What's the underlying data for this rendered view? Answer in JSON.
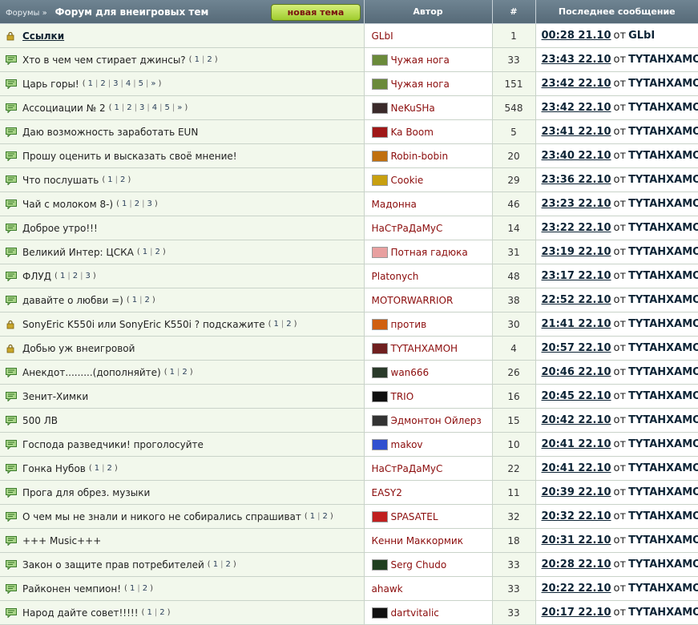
{
  "header": {
    "breadcrumb": "Форумы »",
    "title": "Форум для внеигровых тем",
    "new_topic_button": "новая тема",
    "col_author": "Автор",
    "col_count": "#",
    "col_last": "Последнее сообщение"
  },
  "colors": {
    "header_bg": "#607583",
    "row_bg": "#f2f8ec",
    "author_color": "#8b0c0c",
    "button_green": "#b6dc4e"
  },
  "topics": [
    {
      "title": "Ссылки",
      "bold": true,
      "icon": "lock-icon",
      "pages": [],
      "author": "GLbI",
      "avatar": null,
      "count": "1",
      "last_time": "00:28 21.10",
      "last_user": "GLbI"
    },
    {
      "title": "Хто в чем чем стирает джинсы?",
      "icon": "topic-icon",
      "pages": [
        "1",
        "2"
      ],
      "author": "Чужая нога",
      "avatar": {
        "name": "smiley-avatar-icon",
        "color": "#6a8a3a"
      },
      "count": "33",
      "last_time": "23:43 22.10",
      "last_user": "TYTAHXAMOH"
    },
    {
      "title": "Царь горы!",
      "icon": "topic-icon",
      "pages": [
        "1",
        "2",
        "3",
        "4",
        "5",
        "»"
      ],
      "author": "Чужая нога",
      "avatar": {
        "name": "smiley-avatar-icon",
        "color": "#6a8a3a"
      },
      "count": "151",
      "last_time": "23:42 22.10",
      "last_user": "TYTAHXAMOH"
    },
    {
      "title": "Ассоциации № 2",
      "icon": "topic-icon",
      "pages": [
        "1",
        "2",
        "3",
        "4",
        "5",
        "»"
      ],
      "author": "NeKuSHa",
      "avatar": {
        "name": "dark-avatar-icon",
        "color": "#3a2a2a"
      },
      "count": "548",
      "last_time": "23:42 22.10",
      "last_user": "TYTAHXAMOH"
    },
    {
      "title": "Даю возможность заработать EUN",
      "icon": "topic-icon",
      "pages": [],
      "author": "Ka Boom",
      "avatar": {
        "name": "red-d-avatar-icon",
        "color": "#a01818"
      },
      "count": "5",
      "last_time": "23:41 22.10",
      "last_user": "TYTAHXAMOH"
    },
    {
      "title": "Прошу оценить и высказать своё мнение!",
      "icon": "topic-icon",
      "pages": [],
      "author": "Robin-bobin",
      "avatar": {
        "name": "ww-avatar-icon",
        "color": "#c07010"
      },
      "count": "20",
      "last_time": "23:40 22.10",
      "last_user": "TYTAHXAMOH"
    },
    {
      "title": "Что послушать",
      "icon": "topic-icon",
      "pages": [
        "1",
        "2"
      ],
      "author": "Cookie",
      "avatar": {
        "name": "06-avatar-icon",
        "color": "#c8a010"
      },
      "count": "29",
      "last_time": "23:36 22.10",
      "last_user": "TYTAHXAMOH"
    },
    {
      "title": "Чай с молоком 8-)",
      "icon": "topic-icon",
      "pages": [
        "1",
        "2",
        "3"
      ],
      "author": "Мадонна",
      "avatar": null,
      "count": "46",
      "last_time": "23:23 22.10",
      "last_user": "TYTAHXAMOH"
    },
    {
      "title": "Доброе утро!!!",
      "icon": "topic-icon",
      "pages": [],
      "author": "НаСтРаДаМуС",
      "avatar": null,
      "count": "14",
      "last_time": "23:22 22.10",
      "last_user": "TYTAHXAMOH"
    },
    {
      "title": "Великий Интер: ЦСКА",
      "icon": "topic-icon",
      "pages": [
        "1",
        "2"
      ],
      "author": "Потная гадюка",
      "avatar": {
        "name": "pink-avatar-icon",
        "color": "#e8a0a0"
      },
      "count": "31",
      "last_time": "23:19 22.10",
      "last_user": "TYTAHXAMOH"
    },
    {
      "title": "ФЛУД",
      "icon": "topic-icon",
      "pages": [
        "1",
        "2",
        "3"
      ],
      "author": "Platonych",
      "avatar": null,
      "count": "48",
      "last_time": "23:17 22.10",
      "last_user": "TYTAHXAMOH"
    },
    {
      "title": "давайте о любви =)",
      "icon": "topic-icon",
      "pages": [
        "1",
        "2"
      ],
      "author": "MOTORWARRIOR",
      "avatar": null,
      "count": "38",
      "last_time": "22:52 22.10",
      "last_user": "TYTAHXAMOH"
    },
    {
      "title": "SonyEric K550i или SonyEric K550i ? подскажите",
      "icon": "lock-icon",
      "pages": [
        "1",
        "2"
      ],
      "author": "против",
      "avatar": {
        "name": "fire-avatar-icon",
        "color": "#d06010"
      },
      "count": "30",
      "last_time": "21:41 22.10",
      "last_user": "TYTAHXAMOH"
    },
    {
      "title": "Добью уж внеигровой",
      "icon": "lock-icon",
      "pages": [],
      "author": "TYTAHXAMOH",
      "avatar": {
        "name": "skull-avatar-icon",
        "color": "#702020"
      },
      "count": "4",
      "last_time": "20:57 22.10",
      "last_user": "TYTAHXAMOH"
    },
    {
      "title": "Анекдот.........(дополняйте)",
      "icon": "topic-icon",
      "pages": [
        "1",
        "2"
      ],
      "author": "wan666",
      "avatar": {
        "name": "dark-avatar-icon",
        "color": "#2a3a2a"
      },
      "count": "26",
      "last_time": "20:46 22.10",
      "last_user": "TYTAHXAMOH"
    },
    {
      "title": "Зенит-Химки",
      "icon": "topic-icon",
      "pages": [],
      "author": "TRIO",
      "avatar": {
        "name": "ite-avatar-icon",
        "color": "#111111"
      },
      "count": "16",
      "last_time": "20:45 22.10",
      "last_user": "TYTAHXAMOH"
    },
    {
      "title": "500 ЛВ",
      "icon": "topic-icon",
      "pages": [],
      "author": "Эдмонтон Ойлерз",
      "avatar": {
        "name": "pixel-avatar-icon",
        "color": "#333333"
      },
      "count": "15",
      "last_time": "20:42 22.10",
      "last_user": "TYTAHXAMOH"
    },
    {
      "title": "Господа разведчики! проголосуйте",
      "icon": "topic-icon",
      "pages": [],
      "author": "makov",
      "avatar": {
        "name": "blue-avatar-icon",
        "color": "#3050d0"
      },
      "count": "10",
      "last_time": "20:41 22.10",
      "last_user": "TYTAHXAMOH"
    },
    {
      "title": "Гонка Нубов",
      "icon": "topic-icon",
      "pages": [
        "1",
        "2"
      ],
      "author": "НаСтРаДаМуС",
      "avatar": null,
      "count": "22",
      "last_time": "20:41 22.10",
      "last_user": "TYTAHXAMOH"
    },
    {
      "title": "Прога для обрез. музыки",
      "icon": "topic-icon",
      "pages": [],
      "author": "EASY2",
      "avatar": null,
      "count": "11",
      "last_time": "20:39 22.10",
      "last_user": "TYTAHXAMOH"
    },
    {
      "title": "О чем мы не знали и никого не собирались спрашиват",
      "icon": "topic-icon",
      "pages": [
        "1",
        "2"
      ],
      "author": "SPASATEL",
      "avatar": {
        "name": "flag-avatar-icon",
        "color": "#c02020"
      },
      "count": "32",
      "last_time": "20:32 22.10",
      "last_user": "TYTAHXAMOH"
    },
    {
      "title": "+++ Music+++",
      "icon": "topic-icon",
      "pages": [],
      "author": "Кенни Маккормик",
      "avatar": null,
      "count": "18",
      "last_time": "20:31 22.10",
      "last_user": "TYTAHXAMOH"
    },
    {
      "title": "Закон о защите прав потребителей",
      "icon": "topic-icon",
      "pages": [
        "1",
        "2"
      ],
      "author": "Serg Chudo",
      "avatar": {
        "name": "green-avatar-icon",
        "color": "#204020"
      },
      "count": "33",
      "last_time": "20:28 22.10",
      "last_user": "TYTAHXAMOH"
    },
    {
      "title": "Райконен чемпион!",
      "icon": "topic-icon",
      "pages": [
        "1",
        "2"
      ],
      "author": "ahawk",
      "avatar": null,
      "count": "33",
      "last_time": "20:22 22.10",
      "last_user": "TYTAHXAMOH"
    },
    {
      "title": "Народ дайте совет!!!!!",
      "icon": "topic-icon",
      "pages": [
        "1",
        "2"
      ],
      "author": "dartvitalic",
      "avatar": {
        "name": "ite-avatar-icon",
        "color": "#111111"
      },
      "count": "33",
      "last_time": "20:17 22.10",
      "last_user": "TYTAHXAMOH"
    }
  ],
  "last_separator": "от"
}
